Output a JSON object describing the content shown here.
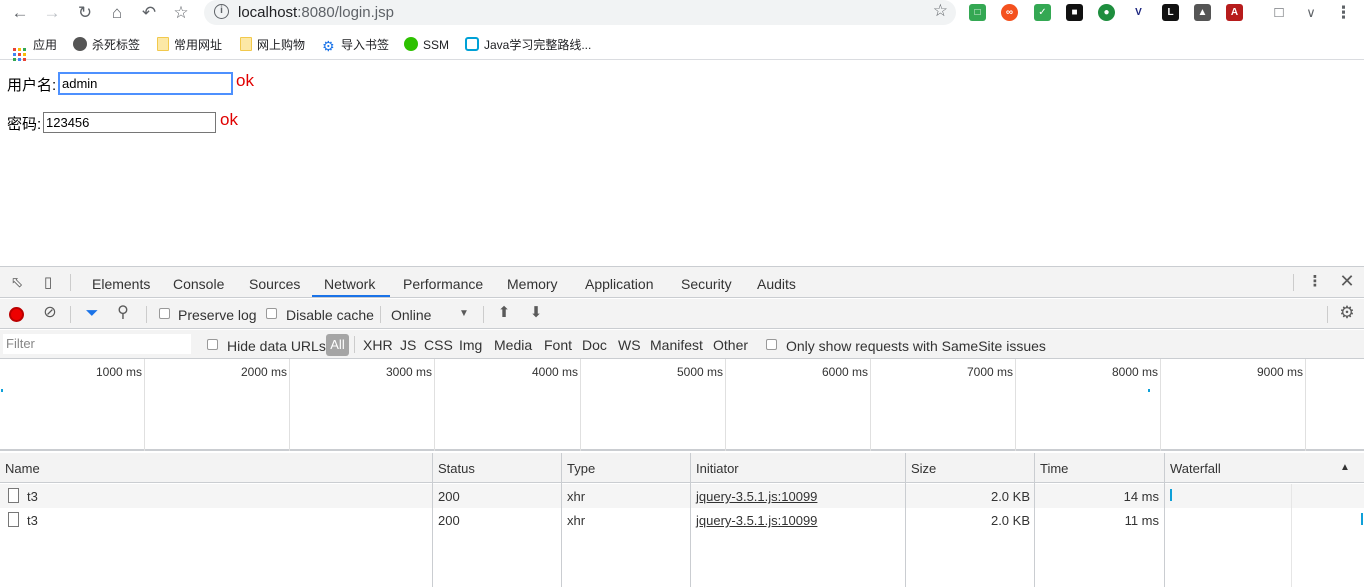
{
  "browser": {
    "url_host": "localhost",
    "url_path": ":8080/login.jsp",
    "bookmarks": [
      {
        "label": "应用"
      },
      {
        "label": "杀死标签"
      },
      {
        "label": "常用网址"
      },
      {
        "label": "网上购物"
      },
      {
        "label": "导入书签"
      },
      {
        "label": "SSM"
      },
      {
        "label": "Java学习完整路线..."
      }
    ]
  },
  "form": {
    "username_label": "用户名:",
    "username_value": "admin",
    "username_status": "ok",
    "password_label": "密码:",
    "password_value": "123456",
    "password_status": "ok"
  },
  "devtools": {
    "tabs": [
      "Elements",
      "Console",
      "Sources",
      "Network",
      "Performance",
      "Memory",
      "Application",
      "Security",
      "Audits"
    ],
    "active_tab": "Network",
    "toolbar": {
      "preserve_log": "Preserve log",
      "disable_cache": "Disable cache",
      "throttle": "Online"
    },
    "filter": {
      "placeholder": "Filter",
      "hide_data_urls": "Hide data URLs",
      "types": [
        "All",
        "XHR",
        "JS",
        "CSS",
        "Img",
        "Media",
        "Font",
        "Doc",
        "WS",
        "Manifest",
        "Other"
      ],
      "samesite": "Only show requests with SameSite issues"
    },
    "timeline_labels": [
      "1000 ms",
      "2000 ms",
      "3000 ms",
      "4000 ms",
      "5000 ms",
      "6000 ms",
      "7000 ms",
      "8000 ms",
      "9000 ms"
    ],
    "columns": [
      "Name",
      "Status",
      "Type",
      "Initiator",
      "Size",
      "Time",
      "Waterfall"
    ],
    "rows": [
      {
        "name": "t3",
        "status": "200",
        "type": "xhr",
        "initiator": "jquery-3.5.1.js:10099",
        "size": "2.0 KB",
        "time": "14 ms"
      },
      {
        "name": "t3",
        "status": "200",
        "type": "xhr",
        "initiator": "jquery-3.5.1.js:10099",
        "size": "2.0 KB",
        "time": "11 ms"
      }
    ]
  }
}
